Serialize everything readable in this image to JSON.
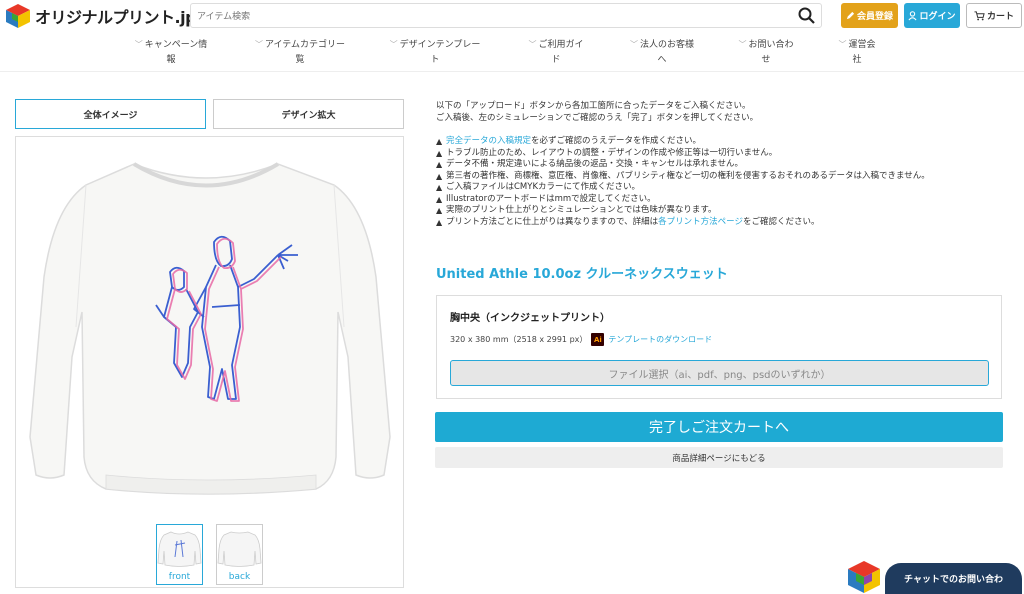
{
  "header": {
    "logo_text": "オリジナルプリント.jp",
    "search_placeholder": "アイテム検索",
    "register_label": "会員登録",
    "login_label": "ログイン",
    "cart_label": "カート"
  },
  "nav": {
    "items": [
      {
        "line1": "キャンペーン情",
        "line2": "報"
      },
      {
        "line1": "アイテムカテゴリー",
        "line2": "覧"
      },
      {
        "line1": "デザインテンプレー",
        "line2": "ト"
      },
      {
        "line1": "ご利用ガイ",
        "line2": "ド"
      },
      {
        "line1": "法人のお客様",
        "line2": "へ"
      },
      {
        "line1": "お問い合わ",
        "line2": "せ"
      },
      {
        "line1": "運営会",
        "line2": "社"
      }
    ]
  },
  "tabs": {
    "overall": "全体イメージ",
    "zoom": "デザイン拡大"
  },
  "thumbs": {
    "front": "front",
    "back": "back"
  },
  "info": {
    "line1": "以下の「アップロード」ボタンから各加工箇所に合ったデータをご入稿ください。",
    "line2": "ご入稿後、左のシミュレーションでご確認のうえ「完了」ボタンを押してください。"
  },
  "notes": {
    "n1_link": "完全データの入稿規定",
    "n1_rest": "を必ずご確認のうえデータを作成ください。",
    "n2": "トラブル防止のため、レイアウトの調整・デザインの作成や修正等は一切行いません。",
    "n3": "データ不備・規定違いによる納品後の返品・交換・キャンセルは承れません。",
    "n4": "第三者の著作権、商標権、意匠権、肖像権、パブリシティ権など一切の権利を侵害するおそれのあるデータは入稿できません。",
    "n5": "ご入稿ファイルはCMYKカラーにて作成ください。",
    "n6": "Illustratorのアートボードはmmで設定してください。",
    "n7": "実際のプリント仕上がりとシミュレーションとでは色味が異なります。",
    "n8_pre": "プリント方法ごとに仕上がりは異なりますので、詳細は",
    "n8_link": "各プリント方法ページ",
    "n8_post": "をご確認ください。"
  },
  "product": {
    "title": "United Athle 10.0oz クルーネックスウェット"
  },
  "upload": {
    "title": "胸中央（インクジェットプリント）",
    "size": "320 x 380 mm（2518 x 2991 px）",
    "ai_badge": "Ai",
    "template_link": "テンプレートのダウンロード",
    "file_button": "ファイル選択（ai、pdf、png、psdのいずれか）"
  },
  "actions": {
    "complete": "完了しご注文カートへ",
    "back": "商品詳細ページにもどる"
  },
  "chat": {
    "label": "チャットでのお問い合わ"
  },
  "colors": {
    "accent": "#28a8d8",
    "register": "#e3a21a",
    "chat": "#1f3b5e"
  }
}
